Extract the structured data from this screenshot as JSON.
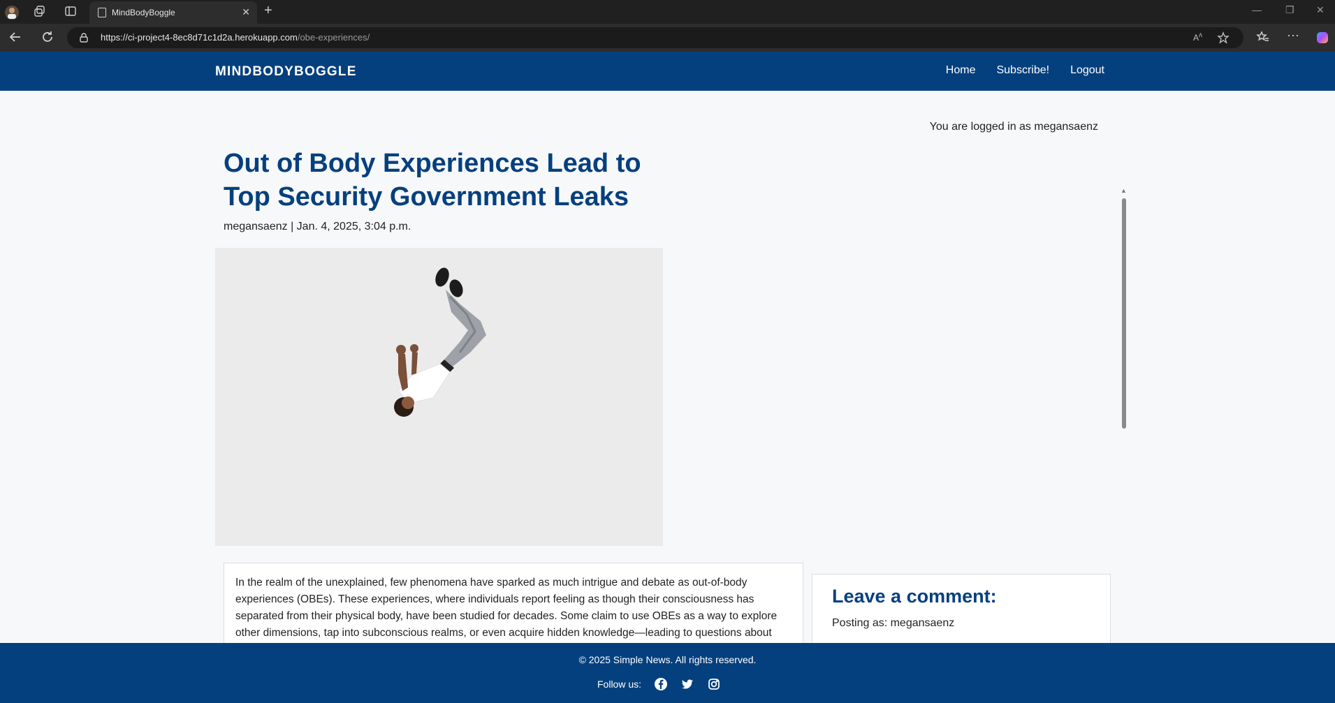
{
  "browser": {
    "tab_title": "MindBodyBoggle",
    "url_host": "https://ci-project4-8ec8d71c1d2a.herokuapp.com",
    "url_path": "/obe-experiences/"
  },
  "site": {
    "brand": "MINDBODYBOGGLE",
    "nav": [
      "Home",
      "Subscribe!",
      "Logout"
    ]
  },
  "status": {
    "logged_in_text": "You are logged in as megansaenz"
  },
  "post": {
    "title": "Out of Body Experiences Lead to Top Security Government Leaks",
    "meta": "megansaenz | Jan. 4, 2025, 3:04 p.m.",
    "body": "In the realm of the unexplained, few phenomena have sparked as much intrigue and debate as out-of-body experiences (OBEs). These experiences, where individuals report feeling as though their consciousness has separated from their physical body, have been studied for decades. Some claim to use OBEs as a way to explore other dimensions, tap into subconscious realms, or even acquire hidden knowledge—leading to questions about"
  },
  "comment": {
    "heading": "Leave a comment:",
    "posting_as": "Posting as: megansaenz"
  },
  "footer": {
    "copyright": "© 2025 Simple News. All rights reserved.",
    "follow_label": "Follow us:"
  },
  "icons": [
    "profile-avatar-icon",
    "workspaces-icon",
    "tab-actions-icon",
    "page-icon",
    "close-icon",
    "plus-icon",
    "back-icon",
    "refresh-icon",
    "lock-icon",
    "read-aloud-icon",
    "favorite-star-icon",
    "favorites-icon",
    "more-icon",
    "copilot-icon",
    "facebook-icon",
    "twitter-icon",
    "instagram-icon"
  ]
}
